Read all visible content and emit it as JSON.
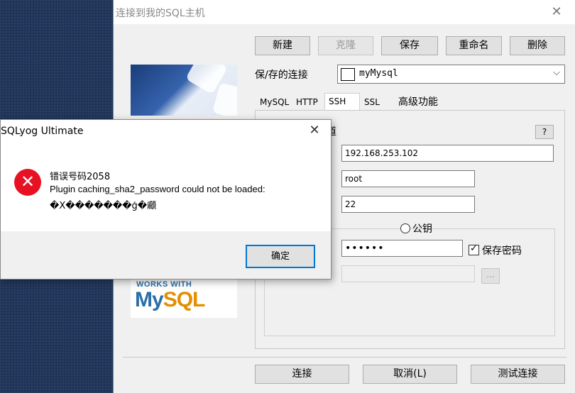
{
  "window": {
    "title": "连接到我的SQL主机",
    "toolbar": {
      "new": "新建",
      "clone": "克隆",
      "save": "保存",
      "rename": "重命名",
      "delete": "删除"
    },
    "saved_connection_label": "保/存的连接",
    "saved_connection_value": "myMysql",
    "tabs": [
      "MySQL",
      "HTTP",
      "SSH",
      "SSL",
      "高级功能"
    ],
    "active_tab": "SSH",
    "ssh_header_fragment": "道",
    "help": "?",
    "ssh": {
      "host": "192.168.253.102",
      "user": "root",
      "port": "22",
      "pubkey_label": "公钥",
      "password": "••••••",
      "save_password_label": "保存密码",
      "browse": "..."
    },
    "footer": {
      "connect": "连接",
      "cancel": "取消(L)",
      "test": "测试连接"
    },
    "logo": {
      "works_with": "WORKS WITH",
      "brand_my": "My",
      "brand_sql": "SQL"
    }
  },
  "error_dialog": {
    "title": "SQLyog Ultimate",
    "error_code": "错误号码2058",
    "message_line1": "Plugin caching_sha2_password could not be loaded:",
    "message_line2": "�X�������ģ�顣",
    "ok": "确定"
  },
  "colors": {
    "desktop": "#1f3458",
    "error_icon": "#e81123",
    "focus_border": "#0078d7"
  }
}
